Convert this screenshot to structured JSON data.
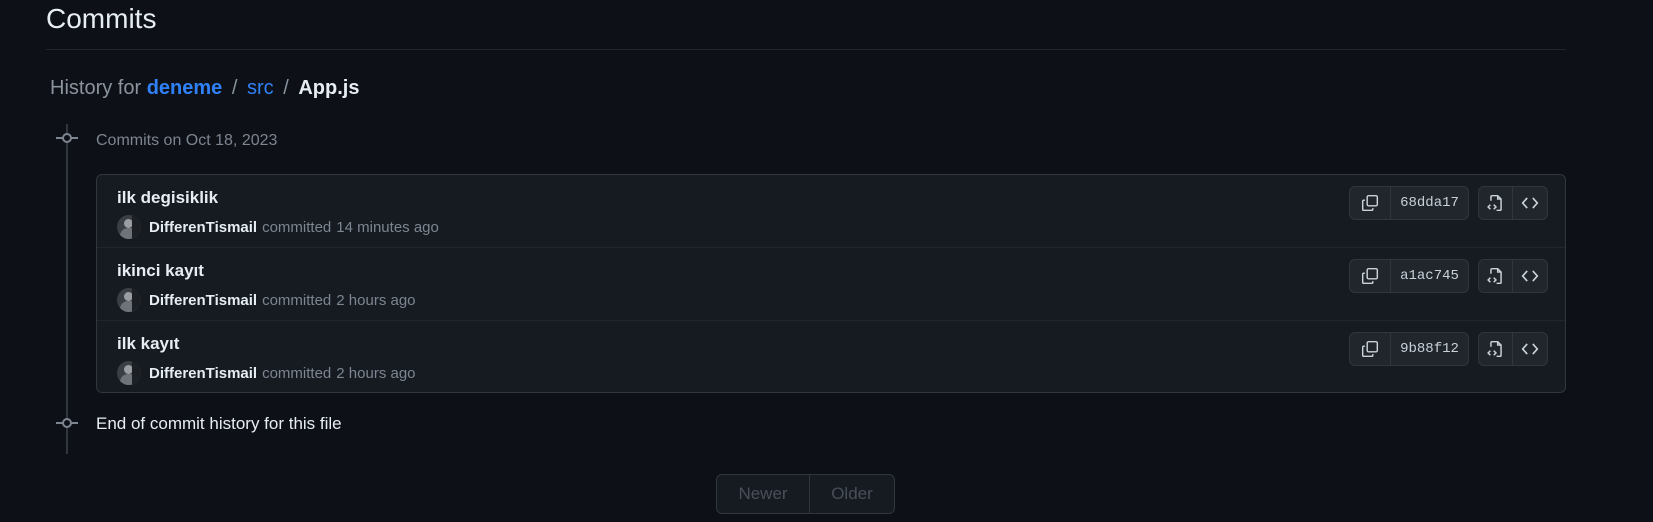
{
  "page": {
    "title": "Commits"
  },
  "breadcrumb": {
    "prefix": "History for",
    "repo": "deneme",
    "folder": "src",
    "file": "App.js",
    "separator": "/"
  },
  "timeline": {
    "group_label": "Commits on Oct 18, 2023",
    "end_label": "End of commit history for this file"
  },
  "commits": [
    {
      "message": "ilk degisiklik",
      "author": "DifferenTismail",
      "action": "committed",
      "time": "14 minutes ago",
      "sha": "68dda17"
    },
    {
      "message": "ikinci kayıt",
      "author": "DifferenTismail",
      "action": "committed",
      "time": "2 hours ago",
      "sha": "a1ac745"
    },
    {
      "message": "ilk kayıt",
      "author": "DifferenTismail",
      "action": "committed",
      "time": "2 hours ago",
      "sha": "9b88f12"
    }
  ],
  "icons": {
    "copy": "copy-icon",
    "browse": "file-code-icon",
    "code": "code-icon",
    "commit_node": "git-commit-icon"
  },
  "pagination": {
    "newer": "Newer",
    "older": "Older"
  },
  "colors": {
    "background": "#0d1117",
    "link": "#2f81f7",
    "muted": "#7d8590",
    "border": "#30363d"
  }
}
